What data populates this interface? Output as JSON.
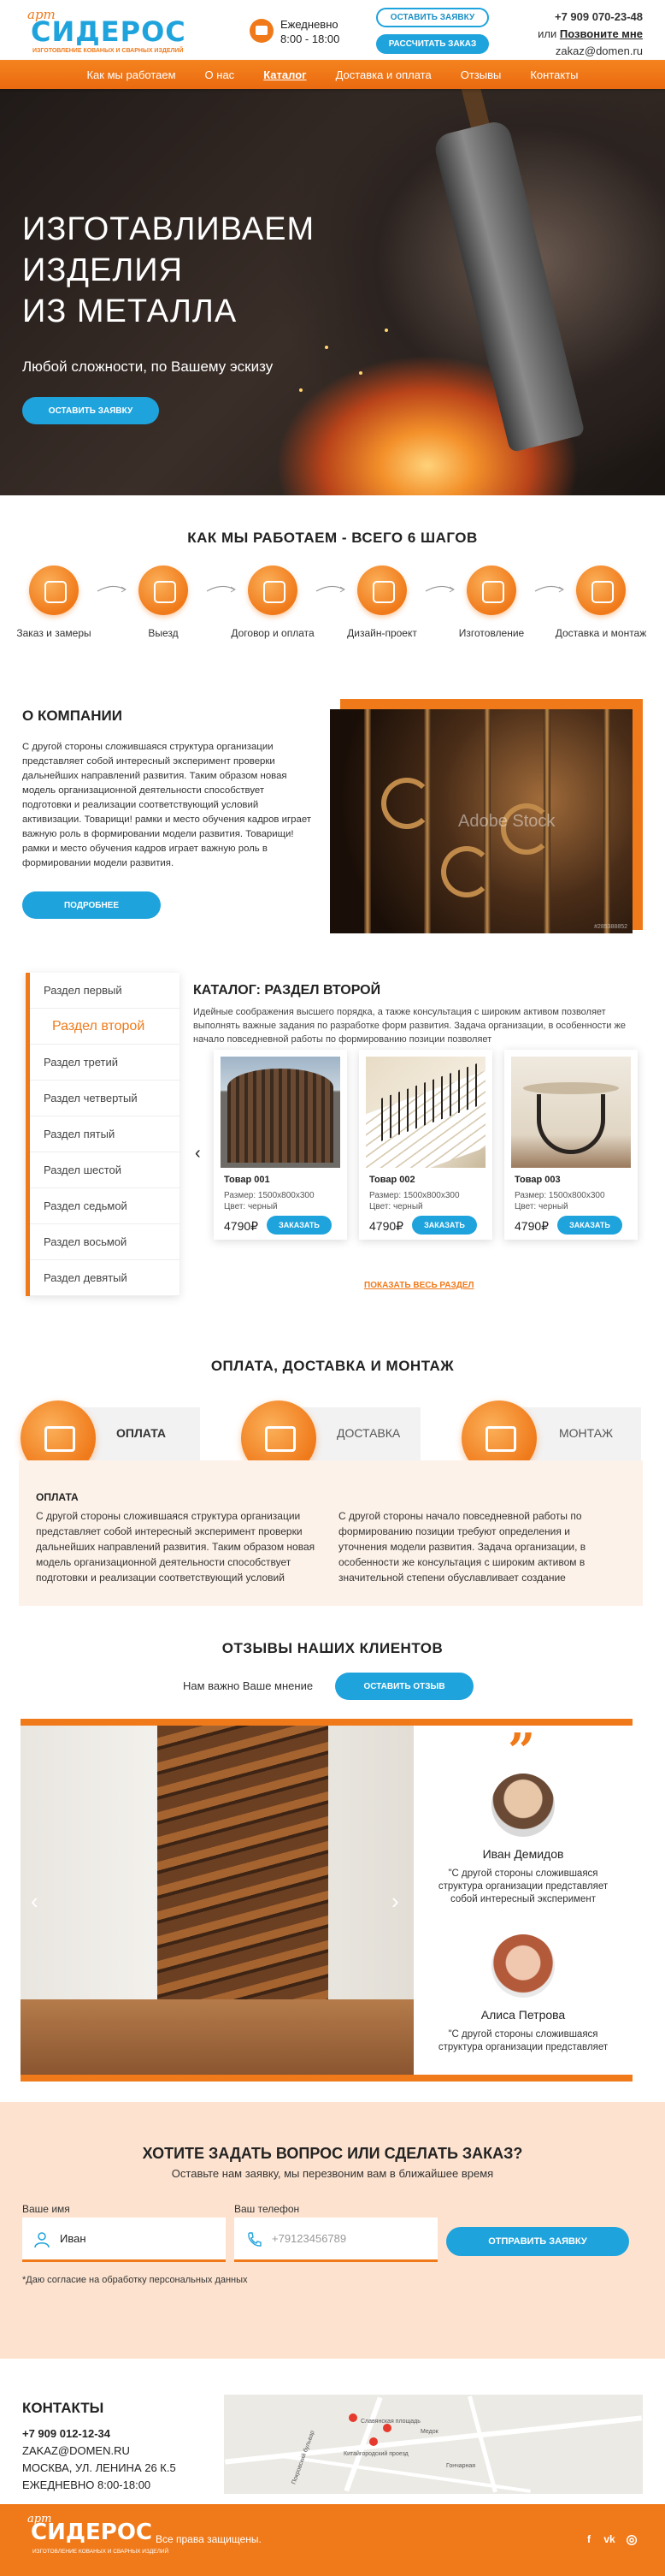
{
  "header": {
    "logo_prefix": "арт",
    "logo_name": "СИДЕРОС",
    "logo_sub": "ИЗГОТОВЛЕНИЕ КОВАНЫХ И СВАРНЫХ ИЗДЕЛИЙ",
    "schedule_line1": "Ежедневно",
    "schedule_line2": "8:00 - 18:00",
    "btn_request": "ОСТАВИТЬ ЗАЯВКУ",
    "btn_calc": "РАССЧИТАТЬ ЗАКАЗ",
    "phone": "+7 909 070-23-48",
    "or": "или",
    "call_me": "Позвоните мне",
    "email": "zakaz@domen.ru"
  },
  "nav": {
    "items": [
      {
        "label": "Как мы работаем"
      },
      {
        "label": "О нас"
      },
      {
        "label": "Каталог"
      },
      {
        "label": "Доставка и оплата"
      },
      {
        "label": "Отзывы"
      },
      {
        "label": "Контакты"
      }
    ]
  },
  "hero": {
    "title_l1": "ИЗГОТАВЛИВАЕМ",
    "title_l2": "ИЗДЕЛИЯ",
    "title_l3": "ИЗ МЕТАЛЛА",
    "lead": "Любой сложности, по Вашему эскизу",
    "cta": "ОСТАВИТЬ ЗАЯВКУ"
  },
  "how": {
    "title": "КАК МЫ РАБОТАЕМ - ВСЕГО 6 ШАГОВ",
    "steps": [
      {
        "label": "Заказ и замеры",
        "icon": "ruler-pencil-icon"
      },
      {
        "label": "Выезд",
        "icon": "car-icon"
      },
      {
        "label": "Договор и оплата",
        "icon": "handshake-icon"
      },
      {
        "label": "Дизайн-проект",
        "icon": "design-icon"
      },
      {
        "label": "Изготовление",
        "icon": "factory-icon"
      },
      {
        "label": "Доставка и монтаж",
        "icon": "wrench-icon"
      }
    ]
  },
  "about": {
    "title": "О КОМПАНИИ",
    "text": "С другой стороны сложившаяся структура организации представляет собой интересный эксперимент проверки дальнейших направлений развития. Таким образом новая модель организационной деятельности способствует подготовки и реализации соответствующий условий активизации. Товарищи! рамки и место обучения кадров играет важную роль в формировании модели развития. Товарищи! рамки и место обучения кадров играет важную роль в формировании модели развития.",
    "btn": "ПОДРОБНЕЕ",
    "watermark": "Adobe Stock",
    "stock_id": "#285388852"
  },
  "catalog": {
    "sections": [
      {
        "label": "Раздел первый"
      },
      {
        "label": "Раздел второй"
      },
      {
        "label": "Раздел третий"
      },
      {
        "label": "Раздел четвертый"
      },
      {
        "label": "Раздел пятый"
      },
      {
        "label": "Раздел шестой"
      },
      {
        "label": "Раздел седьмой"
      },
      {
        "label": "Раздел восьмой"
      },
      {
        "label": "Раздел девятый"
      }
    ],
    "title_bold": "КАТАЛОГ:",
    "title_rest": " РАЗДЕЛ ВТОРОЙ",
    "desc": "Идейные соображения высшего порядка, а также консультация с широким активом позволяет выполнять важные задания по разработке форм развития. Задача организации, в особенности же начало повседневной работы по формированию позиции позволяет",
    "products": [
      {
        "name": "Товар 001",
        "size": "Размер: 1500х800х300",
        "color": "Цвет: черный",
        "price": "4790₽",
        "btn": "ЗАКАЗАТЬ"
      },
      {
        "name": "Товар 002",
        "size": "Размер: 1500х800х300",
        "color": "Цвет: черный",
        "price": "4790₽",
        "btn": "ЗАКАЗАТЬ"
      },
      {
        "name": "Товар 003",
        "size": "Размер: 1500х800х300",
        "color": "Цвет: черный",
        "price": "4790₽",
        "btn": "ЗАКАЗАТЬ"
      }
    ],
    "prev": "‹",
    "next": "›",
    "show_all": "ПОКАЗАТЬ ВЕСЬ РАЗДЕЛ"
  },
  "payment": {
    "title": "ОПЛАТА, ДОСТАВКА И МОНТАЖ",
    "tabs": [
      {
        "label": "ОПЛАТА",
        "icon": "wallet-icon"
      },
      {
        "label": "ДОСТАВКА",
        "icon": "truck-icon"
      },
      {
        "label": "МОНТАЖ",
        "icon": "gears-icon"
      }
    ],
    "content_title": "ОПЛАТА",
    "col1": "С другой стороны сложившаяся структура организации представляет собой интересный эксперимент проверки дальнейших направлений развития. Таким образом новая модель организационной деятельности способствует подготовки и реализации соответствующий условий",
    "col2": "С другой стороны начало повседневной работы по формированию позиции требуют определения и уточнения модели развития. Задача организации, в особенности же консультация с широким активом в значительной степени обуславливает создание"
  },
  "reviews": {
    "title": "ОТЗЫВЫ НАШИХ КЛИЕНТОВ",
    "sub": "Нам важно Ваше мнение",
    "btn": "ОСТАВИТЬ ОТЗЫВ",
    "prev": "‹",
    "next": "›",
    "quote_mark": "”",
    "items": [
      {
        "name": "Иван Демидов",
        "text": "\"С другой стороны сложившаяся структура организации представляет собой интересный эксперимент"
      },
      {
        "name": "Алиса Петрова",
        "text": "\"С другой стороны сложившаяся структура организации представляет"
      }
    ]
  },
  "ask": {
    "title": "ХОТИТЕ ЗАДАТЬ ВОПРОС ИЛИ СДЕЛАТЬ ЗАКАЗ?",
    "sub": "Оставьте нам заявку, мы перезвоним вам в ближайшее время",
    "name_label": "Ваше имя",
    "name_value": "Иван",
    "phone_label": "Ваш телефон",
    "phone_placeholder": "+79123456789",
    "submit": "ОТПРАВИТЬ ЗАЯВКУ",
    "agree": "*Даю согласие на обработку персональных данных"
  },
  "contacts": {
    "title": "КОНТАКТЫ",
    "phone": "+7 909 012-12-34",
    "email": "ZAKAZ@DOMEN.RU",
    "address": "МОСКВА, УЛ. ЛЕНИНА 26 К.5",
    "hours": "ЕЖЕДНЕВНО 8:00-18:00",
    "map_labels": [
      "Славянская площадь",
      "Китайгородский проезд",
      "Покровский бульвар",
      "Гончарная",
      "Медок"
    ]
  },
  "footer": {
    "logo_prefix": "арт",
    "logo_name": "СИДЕРОС",
    "logo_sub": "ИЗГОТОВЛЕНИЕ КОВАНЫХ И СВАРНЫХ ИЗДЕЛИЙ",
    "rights": "Все права защищены.",
    "socials": [
      {
        "icon": "facebook-icon",
        "glyph": "f"
      },
      {
        "icon": "vk-icon",
        "glyph": "vk"
      },
      {
        "icon": "instagram-icon",
        "glyph": "◎"
      }
    ]
  },
  "colors": {
    "accent": "#f07a1a",
    "blue": "#1fa3dc"
  }
}
